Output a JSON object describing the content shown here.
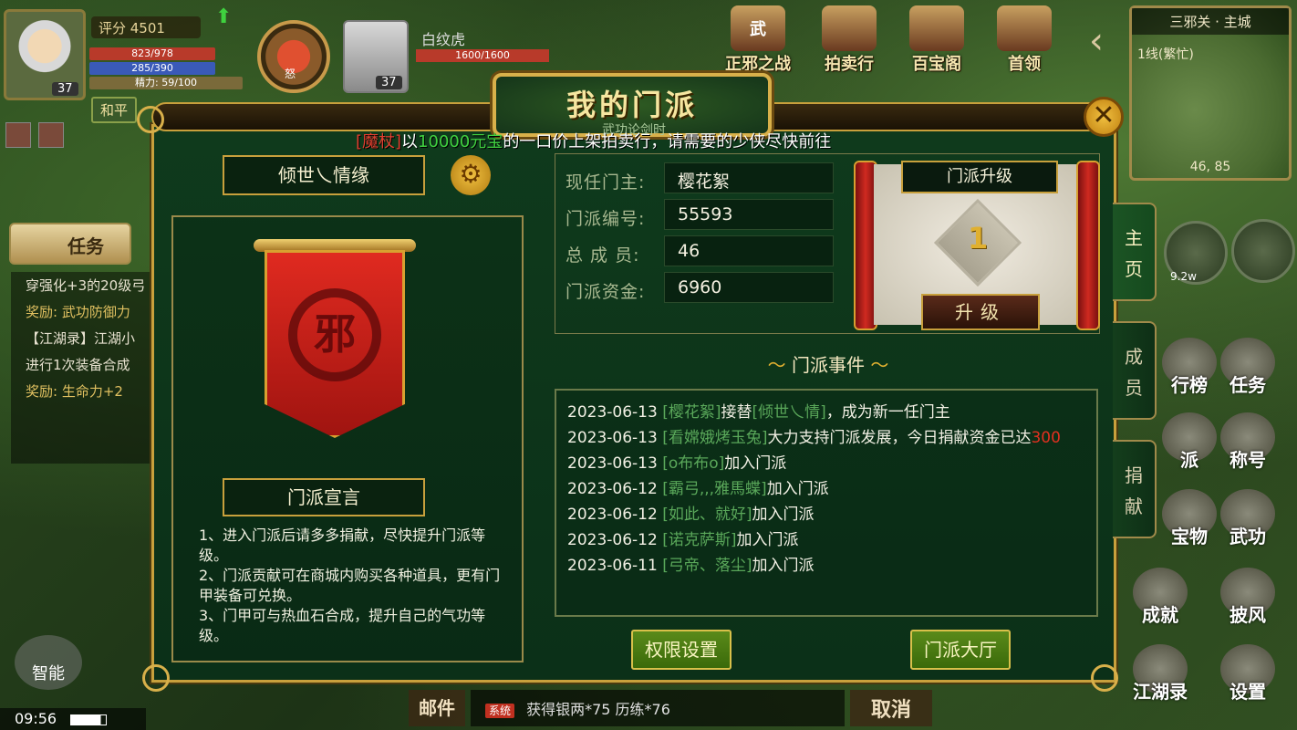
{
  "hud": {
    "score_label": "评分 4501",
    "player_level": "37",
    "hp": "823/978",
    "mp": "285/390",
    "energy": "精力: 59/100",
    "pet_label": "怒",
    "companion_name": "白纹虎",
    "companion_level": "37",
    "companion_hp": "1600/1600",
    "mode_label": "和平",
    "top_icons": [
      "正邪之战",
      "拍卖行",
      "百宝阁",
      "首领"
    ],
    "top_icon_glyph": "武",
    "minimap": {
      "title": "三邪关 · 主城",
      "line": "1线(繁忙)",
      "coord": "46, 85"
    },
    "quest_tab_label": "任务",
    "quests": [
      {
        "text": "穿强化+3的20级弓",
        "reward": "奖励: 武功防御力"
      },
      {
        "text": "【江湖录】江湖小",
        "reward": ""
      },
      {
        "text": "进行1次装备合成",
        "reward": "奖励: 生命力+2"
      }
    ],
    "power_value": "9.2w",
    "right_buttons": [
      "行榜",
      "任务",
      "派",
      "称号",
      "宝物",
      "武功",
      "成就",
      "披风",
      "江湖录",
      "设置"
    ],
    "auto_label": "智能",
    "clock": "09:56",
    "mail_label": "邮件",
    "chat_tag": "系统",
    "chat_text": "获得银两*75 历练*76",
    "cancel_label": "取消"
  },
  "panel": {
    "title": "我的门派",
    "subtitle": "武功论剑时",
    "close_glyph": "✕",
    "broadcast": {
      "item": "[魔杖]",
      "pre": "以",
      "amount": "10000元宝",
      "rest": "的一口价上架拍卖行，请需要的少侠尽快前往"
    },
    "guild_name": "倾世乀情缘",
    "gear_glyph": "⚙",
    "emblem_char": "邪",
    "declaration_title": "门派宣言",
    "declaration_lines": [
      "1、进入门派后请多多捐献，尽快提升门派等级。",
      "2、门派贡献可在商城内购买各种道具，更有门甲装备可兑换。",
      "3、门甲可与热血石合成，提升自己的气功等级。"
    ],
    "info": [
      {
        "key": "现任门主:",
        "value": "樱花絮"
      },
      {
        "key": "门派编号:",
        "value": "55593"
      },
      {
        "key": "总 成 员:",
        "value": "46"
      },
      {
        "key": "门派资金:",
        "value": "6960"
      }
    ],
    "upgrade": {
      "header": "门派升级",
      "level": "1",
      "button": "升级"
    },
    "events_title": "门派事件",
    "events": [
      {
        "date": "2023-06-13",
        "name": "[樱花絮]",
        "text": "接替",
        "name2": "[倾世乀情]",
        "text2": "，成为新一任门主"
      },
      {
        "date": "2023-06-13",
        "name": "[看嫦娥烤玉兔]",
        "text": "大力支持门派发展，今日捐献资金已达",
        "amount": "300"
      },
      {
        "date": "2023-06-13",
        "name": "[o布布o]",
        "text": "加入门派"
      },
      {
        "date": "2023-06-12",
        "name": "[霸弓,,,雅馬蝶]",
        "text": "加入门派"
      },
      {
        "date": "2023-06-12",
        "name": "[如此、就好]",
        "text": "加入门派"
      },
      {
        "date": "2023-06-12",
        "name": "[诺克萨斯]",
        "text": "加入门派"
      },
      {
        "date": "2023-06-11",
        "name": "[弓帝、落尘]",
        "text": "加入门派"
      }
    ],
    "permissions_button": "权限设置",
    "hall_button": "门派大厅",
    "side_tabs": [
      "主页",
      "成员",
      "捐献"
    ]
  }
}
